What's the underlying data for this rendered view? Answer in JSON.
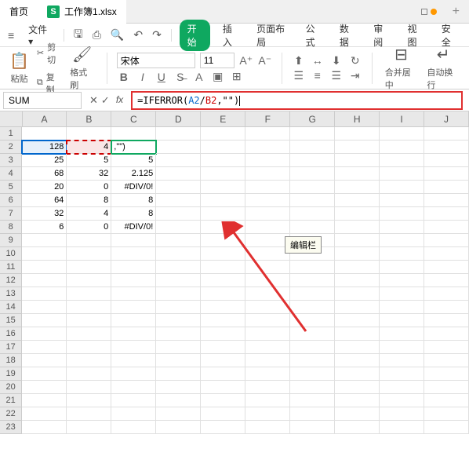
{
  "tabs": {
    "home": "首页",
    "file": "工作簿1.xlsx",
    "add": "+"
  },
  "menu": {
    "file_label": "文件",
    "start": "开始",
    "insert": "插入",
    "page_layout": "页面布局",
    "formula": "公式",
    "data": "数据",
    "review": "审阅",
    "view": "视图",
    "security": "安全"
  },
  "ribbon": {
    "paste": "粘贴",
    "cut": "剪切",
    "copy": "复制",
    "format_painter": "格式刷",
    "font_name": "宋体",
    "font_size": "11",
    "merge_center": "合并居中",
    "wrap": "自动换行"
  },
  "formula_bar": {
    "name_box": "SUM",
    "prefix": "=IFERROR(",
    "ref1": "A2",
    "sep1": "/",
    "ref2": "B2",
    "suffix": ",\"\")"
  },
  "tooltip": "编辑栏",
  "columns": [
    "A",
    "B",
    "C",
    "D",
    "E",
    "F",
    "G",
    "H",
    "I",
    "J"
  ],
  "rows": [
    {
      "n": "1",
      "cells": [
        "",
        "",
        "",
        "",
        "",
        "",
        "",
        "",
        "",
        ""
      ]
    },
    {
      "n": "2",
      "cells": [
        "128",
        "4",
        ",\"\")",
        "",
        "",
        "",
        "",
        "",
        "",
        ""
      ]
    },
    {
      "n": "3",
      "cells": [
        "25",
        "5",
        "5",
        "",
        "",
        "",
        "",
        "",
        "",
        ""
      ]
    },
    {
      "n": "4",
      "cells": [
        "68",
        "32",
        "2.125",
        "",
        "",
        "",
        "",
        "",
        "",
        ""
      ]
    },
    {
      "n": "5",
      "cells": [
        "20",
        "0",
        "#DIV/0!",
        "",
        "",
        "",
        "",
        "",
        "",
        ""
      ]
    },
    {
      "n": "6",
      "cells": [
        "64",
        "8",
        "8",
        "",
        "",
        "",
        "",
        "",
        "",
        ""
      ]
    },
    {
      "n": "7",
      "cells": [
        "32",
        "4",
        "8",
        "",
        "",
        "",
        "",
        "",
        "",
        ""
      ]
    },
    {
      "n": "8",
      "cells": [
        "6",
        "0",
        "#DIV/0!",
        "",
        "",
        "",
        "",
        "",
        "",
        ""
      ]
    },
    {
      "n": "9",
      "cells": [
        "",
        "",
        "",
        "",
        "",
        "",
        "",
        "",
        "",
        ""
      ]
    },
    {
      "n": "10",
      "cells": [
        "",
        "",
        "",
        "",
        "",
        "",
        "",
        "",
        "",
        ""
      ]
    },
    {
      "n": "11",
      "cells": [
        "",
        "",
        "",
        "",
        "",
        "",
        "",
        "",
        "",
        ""
      ]
    },
    {
      "n": "12",
      "cells": [
        "",
        "",
        "",
        "",
        "",
        "",
        "",
        "",
        "",
        ""
      ]
    },
    {
      "n": "13",
      "cells": [
        "",
        "",
        "",
        "",
        "",
        "",
        "",
        "",
        "",
        ""
      ]
    },
    {
      "n": "14",
      "cells": [
        "",
        "",
        "",
        "",
        "",
        "",
        "",
        "",
        "",
        ""
      ]
    },
    {
      "n": "15",
      "cells": [
        "",
        "",
        "",
        "",
        "",
        "",
        "",
        "",
        "",
        ""
      ]
    },
    {
      "n": "16",
      "cells": [
        "",
        "",
        "",
        "",
        "",
        "",
        "",
        "",
        "",
        ""
      ]
    },
    {
      "n": "17",
      "cells": [
        "",
        "",
        "",
        "",
        "",
        "",
        "",
        "",
        "",
        ""
      ]
    },
    {
      "n": "18",
      "cells": [
        "",
        "",
        "",
        "",
        "",
        "",
        "",
        "",
        "",
        ""
      ]
    },
    {
      "n": "19",
      "cells": [
        "",
        "",
        "",
        "",
        "",
        "",
        "",
        "",
        "",
        ""
      ]
    },
    {
      "n": "20",
      "cells": [
        "",
        "",
        "",
        "",
        "",
        "",
        "",
        "",
        "",
        ""
      ]
    },
    {
      "n": "21",
      "cells": [
        "",
        "",
        "",
        "",
        "",
        "",
        "",
        "",
        "",
        ""
      ]
    },
    {
      "n": "22",
      "cells": [
        "",
        "",
        "",
        "",
        "",
        "",
        "",
        "",
        "",
        ""
      ]
    },
    {
      "n": "23",
      "cells": [
        "",
        "",
        "",
        "",
        "",
        "",
        "",
        "",
        "",
        ""
      ]
    }
  ]
}
